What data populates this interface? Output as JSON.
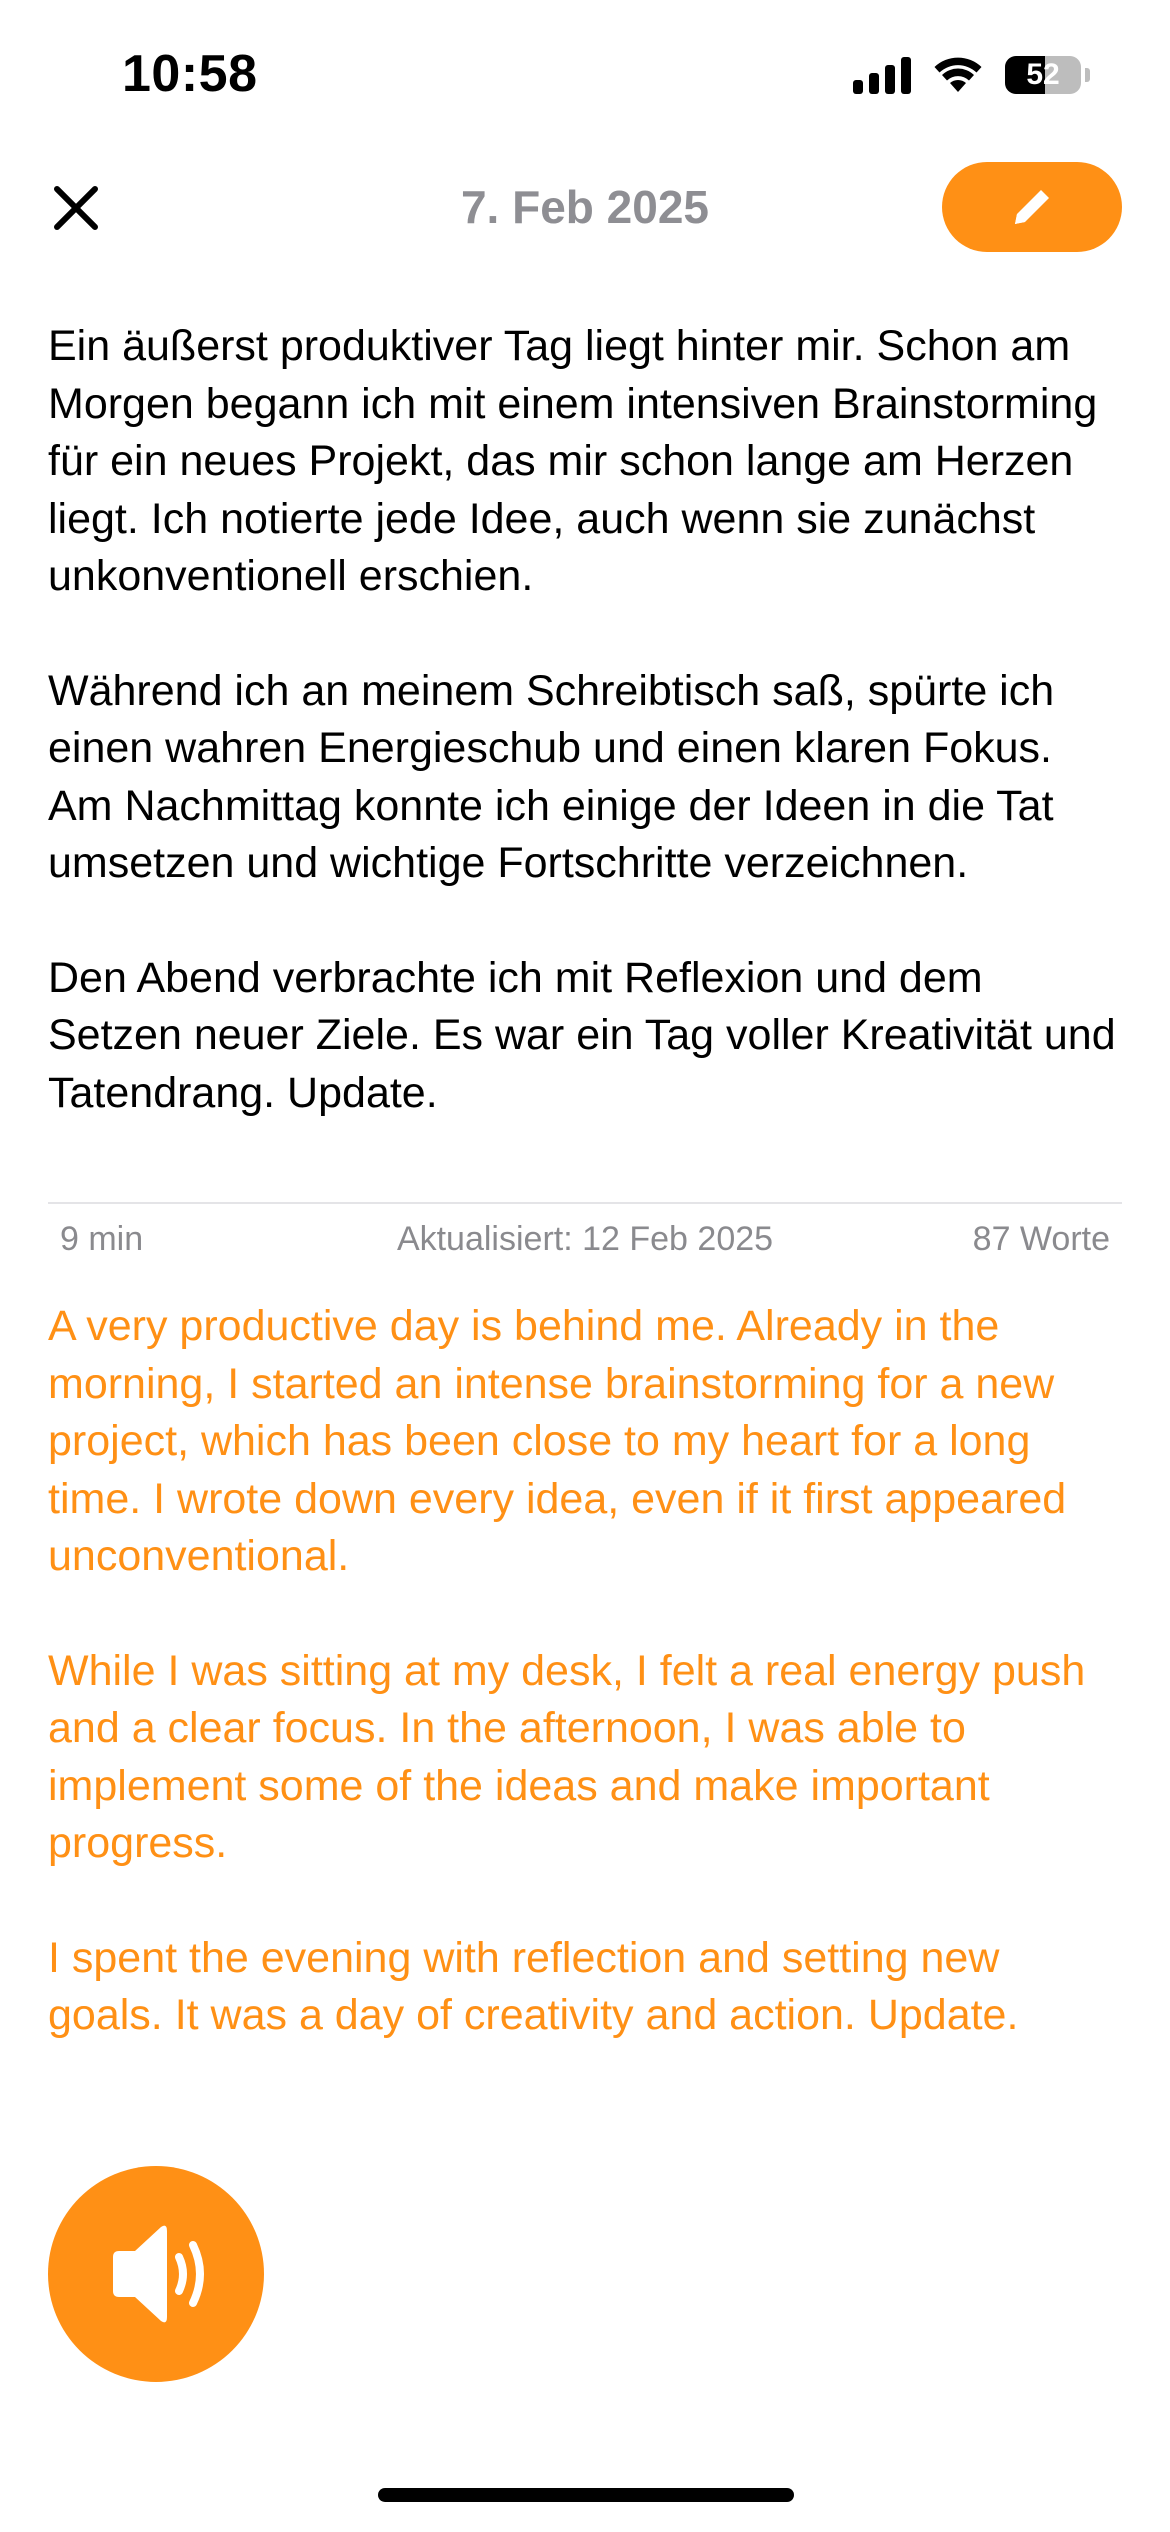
{
  "status_bar": {
    "time": "10:58",
    "battery_level": "52",
    "battery_fraction": 0.52,
    "icons": [
      "cellular-signal-icon",
      "wifi-icon",
      "battery-icon"
    ]
  },
  "header": {
    "title": "7. Feb 2025",
    "close_icon": "close-icon",
    "edit_icon": "pencil-icon",
    "accent_color": "#ff9015"
  },
  "entry": {
    "paragraphs": [
      "Ein äußerst produktiver Tag liegt hinter mir. Schon am Morgen begann ich mit einem intensiven Brainstorming für ein neues Projekt, das mir schon lange am Herzen liegt. Ich notierte jede Idee, auch wenn sie zunächst unkonventionell erschien.",
      "Während ich an meinem Schreibtisch saß, spürte ich einen wahren Energieschub und einen klaren Fokus. Am Nachmittag konnte ich einige der Ideen in die Tat umsetzen und wichtige Fortschritte verzeichnen.",
      "Den Abend verbrachte ich mit Reflexion und dem Setzen neuer Ziele. Es war ein Tag voller Kreativität und Tatendrang. Update."
    ]
  },
  "meta": {
    "duration": "9 min",
    "updated": "Aktualisiert: 12 Feb 2025",
    "word_count": "87 Worte"
  },
  "translation": {
    "paragraphs": [
      "A very productive day is behind me. Already in the morning, I started an intense brainstorming for a new project, which has been close to my heart for a long time. I wrote down every idea, even if it first appeared unconventional.",
      "While I was sitting at my desk, I felt a real energy push and a clear focus. In the afternoon, I was able to implement some of the ideas and make important progress.",
      "I spent the evening with reflection and setting new goals. It was a day of creativity and action. Update."
    ],
    "color": "#ff9015"
  },
  "actions": {
    "speak_icon": "speaker-icon"
  }
}
